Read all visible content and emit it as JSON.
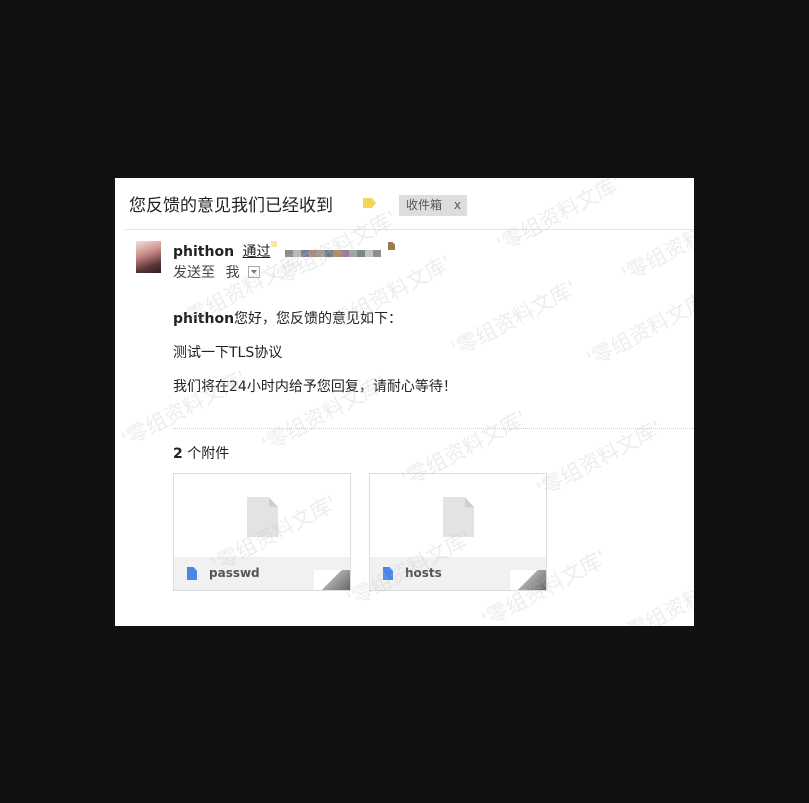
{
  "email": {
    "subject": "您反馈的意见我们已经收到",
    "label": "收件箱",
    "label_close": "x",
    "sender_name": "phithon",
    "via": "通过",
    "to_prefix": "发送至",
    "to_me": "我",
    "greeting_name": "phithon",
    "greeting_rest": "您好，您反馈的意见如下：",
    "line2": "测试一下TLS协议",
    "line3": "我们将在24小时内给予您回复，请耐心等待！"
  },
  "attachments": {
    "count": "2",
    "heading_rest": " 个附件",
    "items": [
      {
        "name": "passwd",
        "icon": "file-icon"
      },
      {
        "name": "hosts",
        "icon": "file-icon"
      }
    ]
  },
  "watermark": "'零组资料文库'",
  "colors": {
    "background": "#111111",
    "panel": "#ffffff",
    "label_tag": "#f6d35a",
    "file_icon": "#4a86e8",
    "chip": "#dddddd"
  }
}
